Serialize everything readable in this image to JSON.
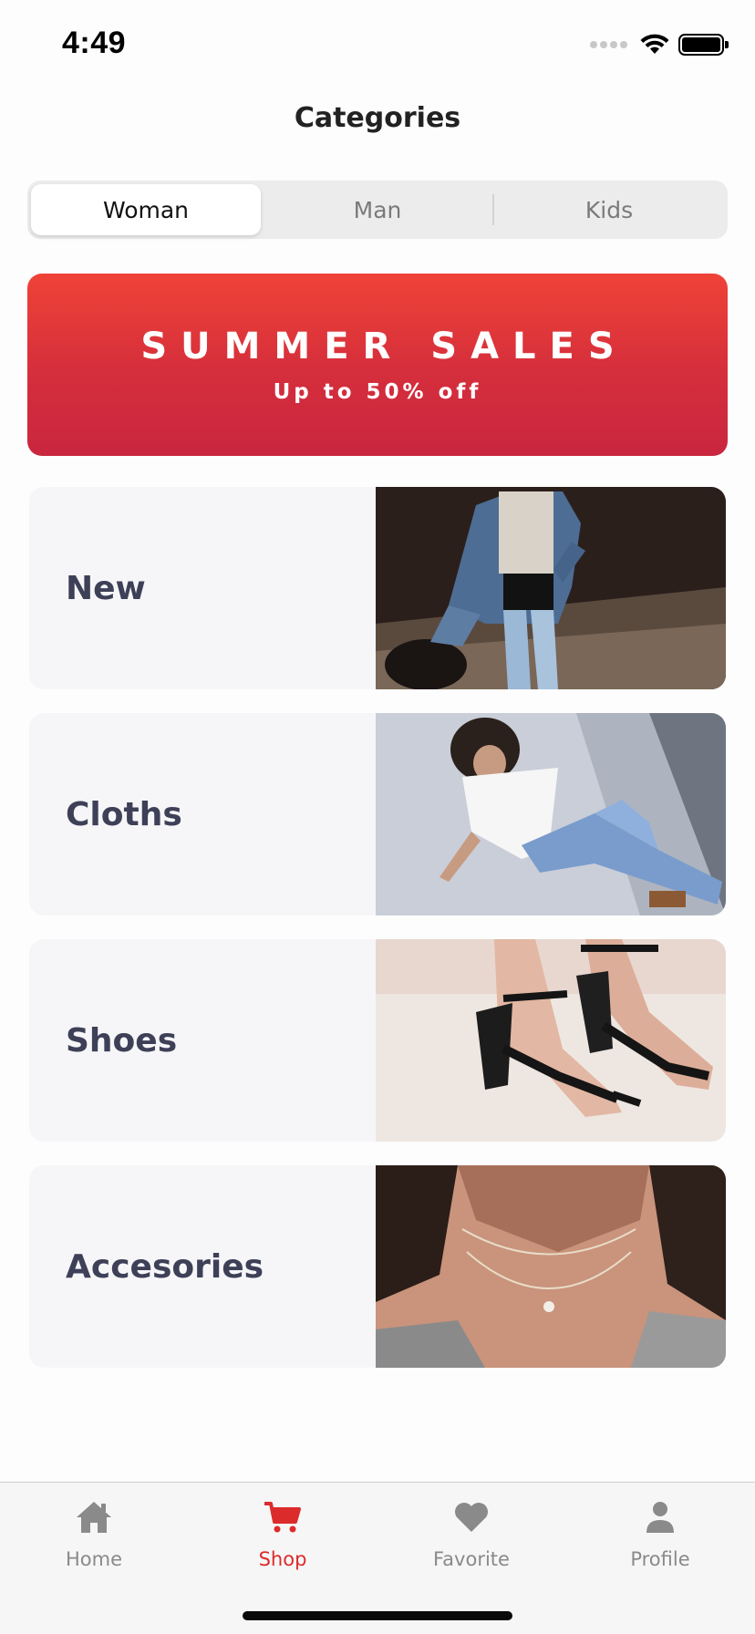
{
  "status_bar": {
    "time": "4:49"
  },
  "header": {
    "title": "Categories"
  },
  "segments": [
    {
      "label": "Woman",
      "active": true
    },
    {
      "label": "Man",
      "active": false
    },
    {
      "label": "Kids",
      "active": false
    }
  ],
  "banner": {
    "title": "SUMMER SALES",
    "subtitle": "Up to 50% off"
  },
  "categories": [
    {
      "label": "New",
      "image": "denim-jacket-photo"
    },
    {
      "label": "Cloths",
      "image": "sitting-jeans-photo"
    },
    {
      "label": "Shoes",
      "image": "strappy-heels-photo"
    },
    {
      "label": "Accesories",
      "image": "necklace-photo"
    }
  ],
  "tab_bar": {
    "items": [
      {
        "label": "Home",
        "icon": "home-icon",
        "active": false
      },
      {
        "label": "Shop",
        "icon": "cart-icon",
        "active": true
      },
      {
        "label": "Favorite",
        "icon": "heart-icon",
        "active": false
      },
      {
        "label": "Profile",
        "icon": "person-icon",
        "active": false
      }
    ]
  },
  "colors": {
    "accent": "#dc2b2b",
    "banner_top": "#ef4337",
    "banner_bottom": "#c9263f",
    "card_bg": "#f6f6f8",
    "card_text": "#3d4057"
  }
}
